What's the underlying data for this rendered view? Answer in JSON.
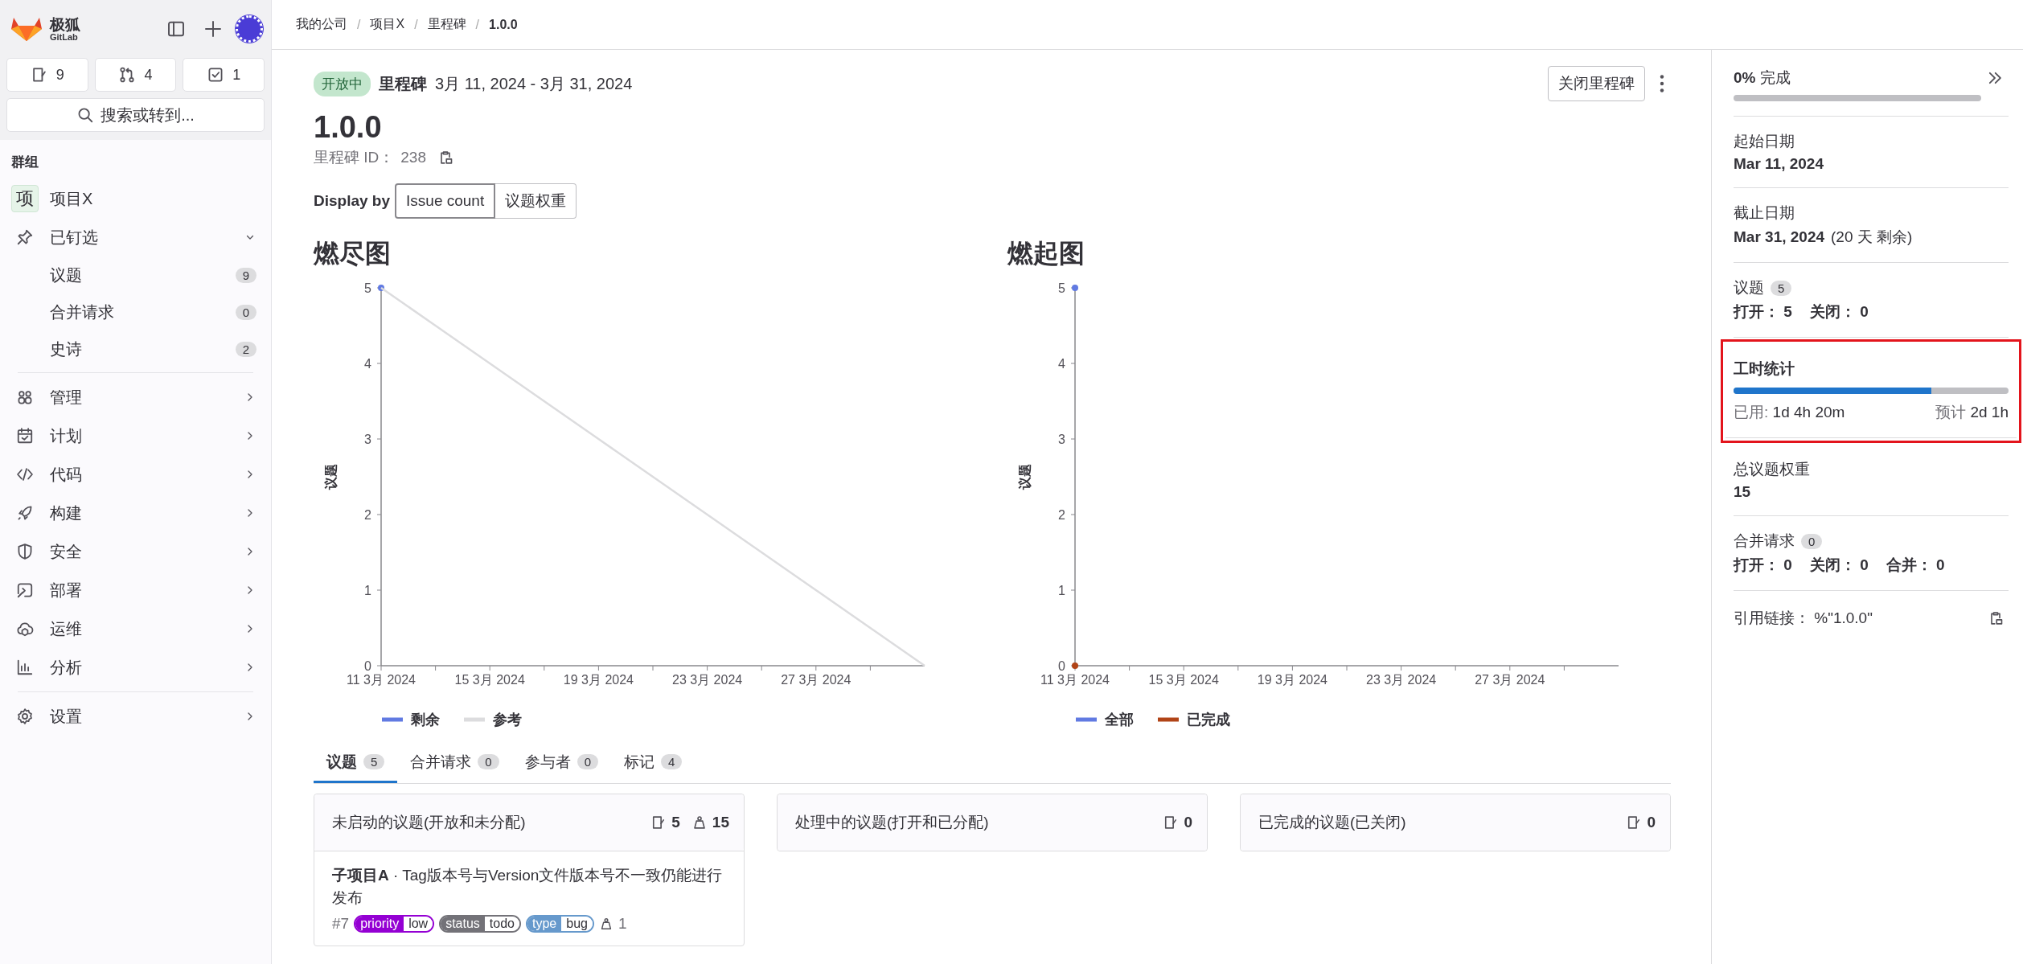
{
  "sidebar": {
    "brand": {
      "name": "极狐",
      "sub": "GitLab"
    },
    "counters": [
      {
        "count": "9"
      },
      {
        "count": "4"
      },
      {
        "count": "1"
      }
    ],
    "search": {
      "label": "搜索或转到..."
    },
    "group_label": "群组",
    "project": {
      "avatar": "项",
      "name": "项目X"
    },
    "pinned": {
      "label": "已钉选",
      "expanded": true,
      "items": [
        {
          "label": "议题",
          "count": "9"
        },
        {
          "label": "合并请求",
          "count": "0"
        },
        {
          "label": "史诗",
          "count": "2"
        }
      ]
    },
    "items": [
      {
        "label": "管理"
      },
      {
        "label": "计划"
      },
      {
        "label": "代码"
      },
      {
        "label": "构建"
      },
      {
        "label": "安全"
      },
      {
        "label": "部署"
      },
      {
        "label": "运维"
      },
      {
        "label": "分析"
      }
    ],
    "footer_item": {
      "label": "设置"
    }
  },
  "breadcrumbs": {
    "separator": "/",
    "items": [
      "我的公司",
      "项目X",
      "里程碑",
      "1.0.0"
    ]
  },
  "milestone": {
    "status": "开放中",
    "type_label": "里程碑",
    "dates": "3月 11, 2024 - 3月 31, 2024",
    "close_button": "关闭里程碑",
    "title": "1.0.0",
    "id_label": "里程碑 ID：",
    "id": "238",
    "display_by": {
      "label": "Display by",
      "options": [
        {
          "label": "Issue count",
          "selected": true
        },
        {
          "label": "议题权重",
          "selected": false
        }
      ]
    }
  },
  "charts": [
    {
      "title": "燃尽图",
      "chart_data": {
        "type": "line",
        "ylabel": "议题",
        "categories": [
          "11 3月 2024",
          null,
          "15 3月 2024",
          null,
          "19 3月 2024",
          null,
          "23 3月 2024",
          null,
          "27 3月 2024",
          null,
          null
        ],
        "ylim": [
          0,
          5
        ],
        "yticks": [
          0,
          1,
          2,
          3,
          4,
          5
        ],
        "series": [
          {
            "name": "剩余",
            "color": "#617ae2",
            "marker": true,
            "values": [
              5,
              null,
              null,
              null,
              null,
              null,
              null,
              null,
              null,
              null,
              null
            ]
          },
          {
            "name": "参考",
            "color": "#dcdcde",
            "marker": false,
            "values": [
              5,
              4.5,
              4,
              3.5,
              3,
              2.5,
              2,
              1.5,
              1,
              0.5,
              0
            ]
          }
        ]
      }
    },
    {
      "title": "燃起图",
      "chart_data": {
        "type": "line",
        "ylabel": "议题",
        "categories": [
          "11 3月 2024",
          null,
          "15 3月 2024",
          null,
          "19 3月 2024",
          null,
          "23 3月 2024",
          null,
          "27 3月 2024",
          null,
          null
        ],
        "ylim": [
          0,
          5
        ],
        "yticks": [
          0,
          1,
          2,
          3,
          4,
          5
        ],
        "series": [
          {
            "name": "全部",
            "color": "#617ae2",
            "marker": true,
            "values": [
              5,
              null,
              null,
              null,
              null,
              null,
              null,
              null,
              null,
              null,
              null
            ]
          },
          {
            "name": "已完成",
            "color": "#b14417",
            "marker": true,
            "values": [
              0,
              null,
              null,
              null,
              null,
              null,
              null,
              null,
              null,
              null,
              null
            ]
          }
        ]
      }
    }
  ],
  "tabs": [
    {
      "label": "议题",
      "count": "5",
      "selected": true
    },
    {
      "label": "合并请求",
      "count": "0",
      "selected": false
    },
    {
      "label": "参与者",
      "count": "0",
      "selected": false
    },
    {
      "label": "标记",
      "count": "4",
      "selected": false
    }
  ],
  "boards": [
    {
      "title": "未启动的议题(开放和未分配)",
      "issues": "5",
      "weight": "15",
      "cards": [
        {
          "title": "**子项目A** · Tag版本号与Version文件版本号不一致仍能进行发布",
          "number": "#7",
          "weight": "1",
          "labels": [
            {
              "key": "priority",
              "value": "low",
              "color": "#9400d3"
            },
            {
              "key": "status",
              "value": "todo",
              "color": "#737278"
            },
            {
              "key": "type",
              "value": "bug",
              "color": "#6699cc"
            }
          ]
        }
      ]
    },
    {
      "title": "处理中的议题(打开和已分配)",
      "issues": "0"
    },
    {
      "title": "已完成的议题(已关闭)",
      "issues": "0"
    }
  ],
  "details": {
    "progress": {
      "label": "**0%** 完成",
      "level": 0
    },
    "start": {
      "label": "起始日期",
      "value": "Mar 11, 2024"
    },
    "due": {
      "label": "截止日期",
      "value": "Mar 31, 2024",
      "note": "(20 天 剩余)"
    },
    "issues": {
      "label": "议题",
      "count": "5",
      "stats": [
        {
          "label": "打开：",
          "value": "5"
        },
        {
          "label": "关闭：",
          "value": "0"
        }
      ]
    },
    "time_tracking": {
      "title": "工时统计",
      "highlighted": true,
      "level": 0.72,
      "spent_label": "已用:",
      "spent": "1d 4h 20m",
      "estimate_label": "预计",
      "estimate": "2d 1h"
    },
    "weight": {
      "label": "总议题权重",
      "value": "15"
    },
    "merge_requests": {
      "label": "合并请求",
      "count": "0",
      "stats": [
        {
          "label": "打开：",
          "value": "0"
        },
        {
          "label": "关闭：",
          "value": "0"
        },
        {
          "label": "合并：",
          "value": "0"
        }
      ]
    },
    "reference": {
      "label": "引用链接：",
      "value": "%\"1.0.0\""
    }
  }
}
